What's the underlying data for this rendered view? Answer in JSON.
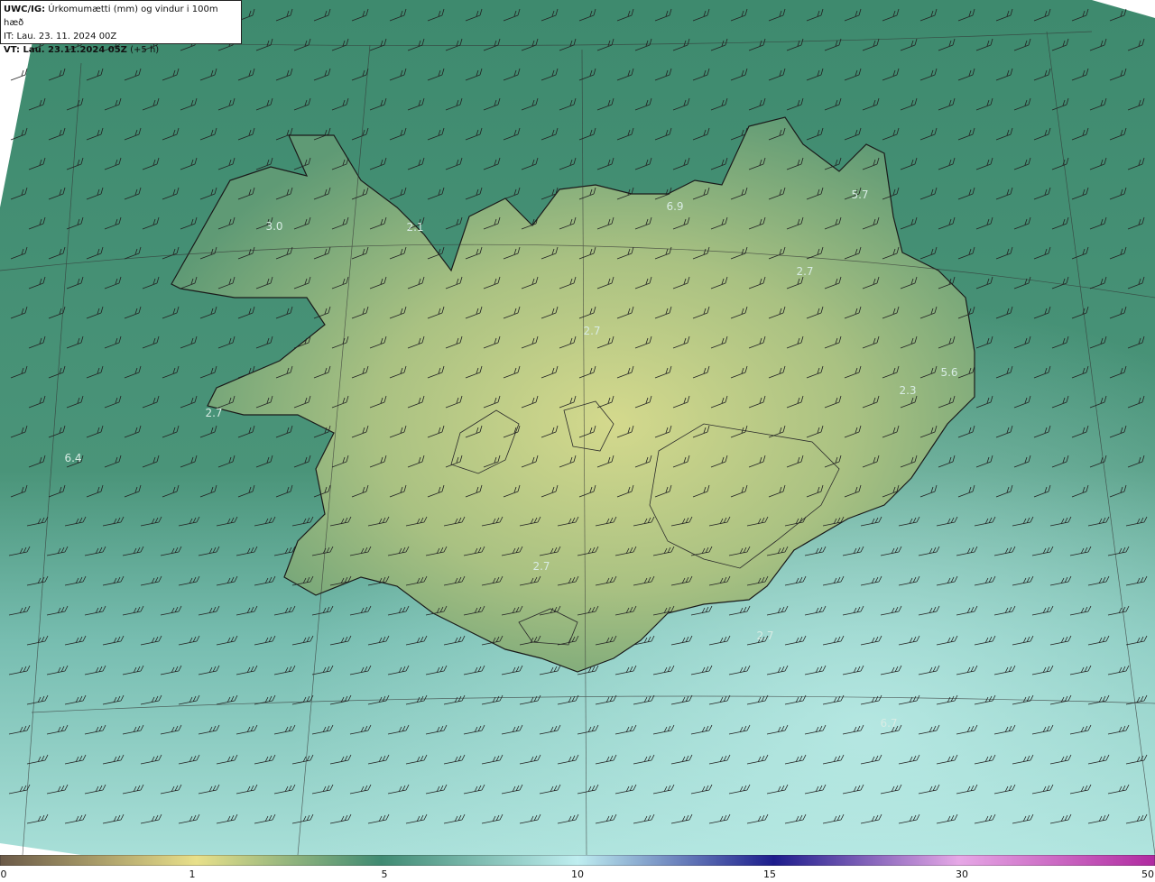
{
  "header": {
    "model_code": "UWC/IG:",
    "title": "Úrkomumætti (mm) og vindur i 100m hæð",
    "initial_time": "IT: Lau. 23. 11. 2024 00Z",
    "valid_prefix": "VT: Lau. 23.11.2024 05Z",
    "valid_suffix": "(+5 h)"
  },
  "map_values": [
    "3.0",
    "2.1",
    "6.9",
    "5.7",
    "2.7",
    "2.7",
    "5.6",
    "2.3",
    "2.7",
    "2.7",
    "6.4",
    "2.7",
    "6.7"
  ],
  "colorbar": {
    "ticks": [
      "0",
      "1",
      "5",
      "10",
      "15",
      "30",
      "50"
    ],
    "colors": [
      "#6b5a48",
      "#b59a6e",
      "#e8e08a",
      "#3f8a72",
      "#bfeef0",
      "#2a2aa0",
      "#b03ab0",
      "#c02aa0"
    ]
  },
  "colors": {
    "sea": "#3f8a72",
    "land_low": "#6aa27a",
    "land_high": "#c9d38a",
    "south_precip": "#9fd6cf",
    "coast": "#1a1a1a",
    "grid": "#3a3a3a"
  }
}
